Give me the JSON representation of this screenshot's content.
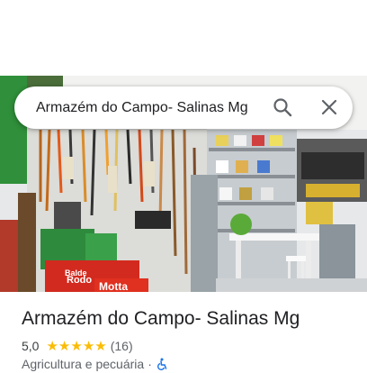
{
  "search": {
    "query": "Armazém do Campo- Salinas Mg"
  },
  "place": {
    "name": "Armazém do Campo- Salinas Mg",
    "rating": "5,0",
    "stars": 5,
    "review_count": "(16)",
    "category": "Agricultura e pecuária",
    "separator": "·"
  },
  "photo": {
    "signs": [
      "Balde",
      "Rodo",
      "Motta"
    ]
  },
  "icons": {
    "search": "search-icon",
    "close": "close-icon",
    "accessibility": "wheelchair-icon"
  },
  "colors": {
    "star": "#fbbc04",
    "icon": "#5f6368",
    "accessible": "#1a73e8"
  }
}
